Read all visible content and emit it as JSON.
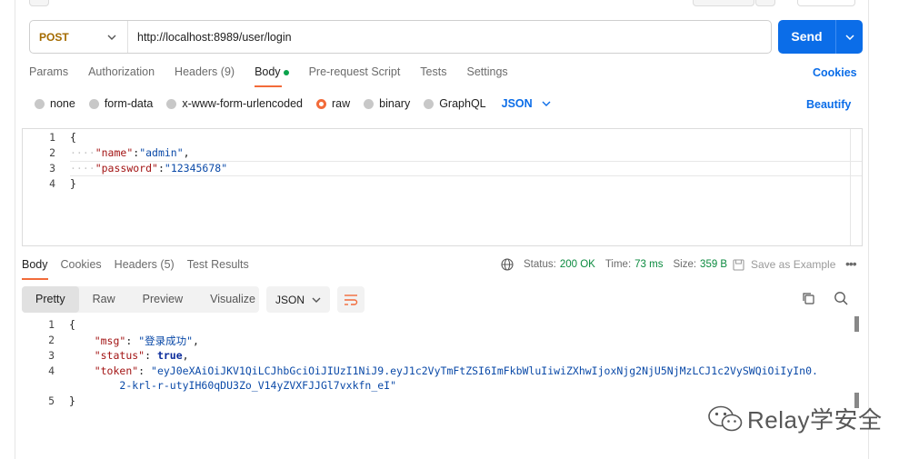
{
  "request": {
    "method": "POST",
    "url": "http://localhost:8989/user/login",
    "send_label": "Send"
  },
  "request_tabs": [
    {
      "label": "Params"
    },
    {
      "label": "Authorization"
    },
    {
      "label": "Headers",
      "count": "(9)"
    },
    {
      "label": "Body"
    },
    {
      "label": "Pre-request Script"
    },
    {
      "label": "Tests"
    },
    {
      "label": "Settings"
    }
  ],
  "cookies_link": "Cookies",
  "body_types": [
    "none",
    "form-data",
    "x-www-form-urlencoded",
    "raw",
    "binary",
    "GraphQL"
  ],
  "body_format": "JSON",
  "beautify_label": "Beautify",
  "request_body": {
    "line_numbers": [
      "1",
      "2",
      "3",
      "4"
    ],
    "open_brace": "{",
    "key_name": "\"name\"",
    "val_name": "\"admin\"",
    "key_password": "\"password\"",
    "val_password": "\"12345678\"",
    "close_brace": "}"
  },
  "response_tabs": [
    {
      "label": "Body"
    },
    {
      "label": "Cookies"
    },
    {
      "label": "Headers",
      "count": "(5)"
    },
    {
      "label": "Test Results"
    }
  ],
  "response_status": {
    "status_label": "Status:",
    "status_value": "200 OK",
    "time_label": "Time:",
    "time_value": "73 ms",
    "size_label": "Size:",
    "size_value": "359 B"
  },
  "save_example_label": "Save as Example",
  "view_modes": [
    "Pretty",
    "Raw",
    "Preview",
    "Visualize"
  ],
  "response_format": "JSON",
  "response_body": {
    "line_numbers": [
      "1",
      "2",
      "3",
      "4",
      "5"
    ],
    "open_brace": "{",
    "key_msg": "\"msg\"",
    "val_msg": "\"登录成功\"",
    "key_status": "\"status\"",
    "val_status": "true",
    "key_token": "\"token\"",
    "val_token_line1": "\"eyJ0eXAiOiJKV1QiLCJhbGciOiJIUzI1NiJ9.eyJ1c2VyTmFtZSI6ImFkbWluIiwiZXhwIjoxNjg2NjU5NjMzLCJ1c2VySWQiOiIyIn0.",
    "val_token_line2": "2-krl-r-utyIH60qDU3Zo_V14yZVXFJJGl7vxkfn_eI\"",
    "close_brace": "}"
  },
  "watermark": "Relay学安全"
}
